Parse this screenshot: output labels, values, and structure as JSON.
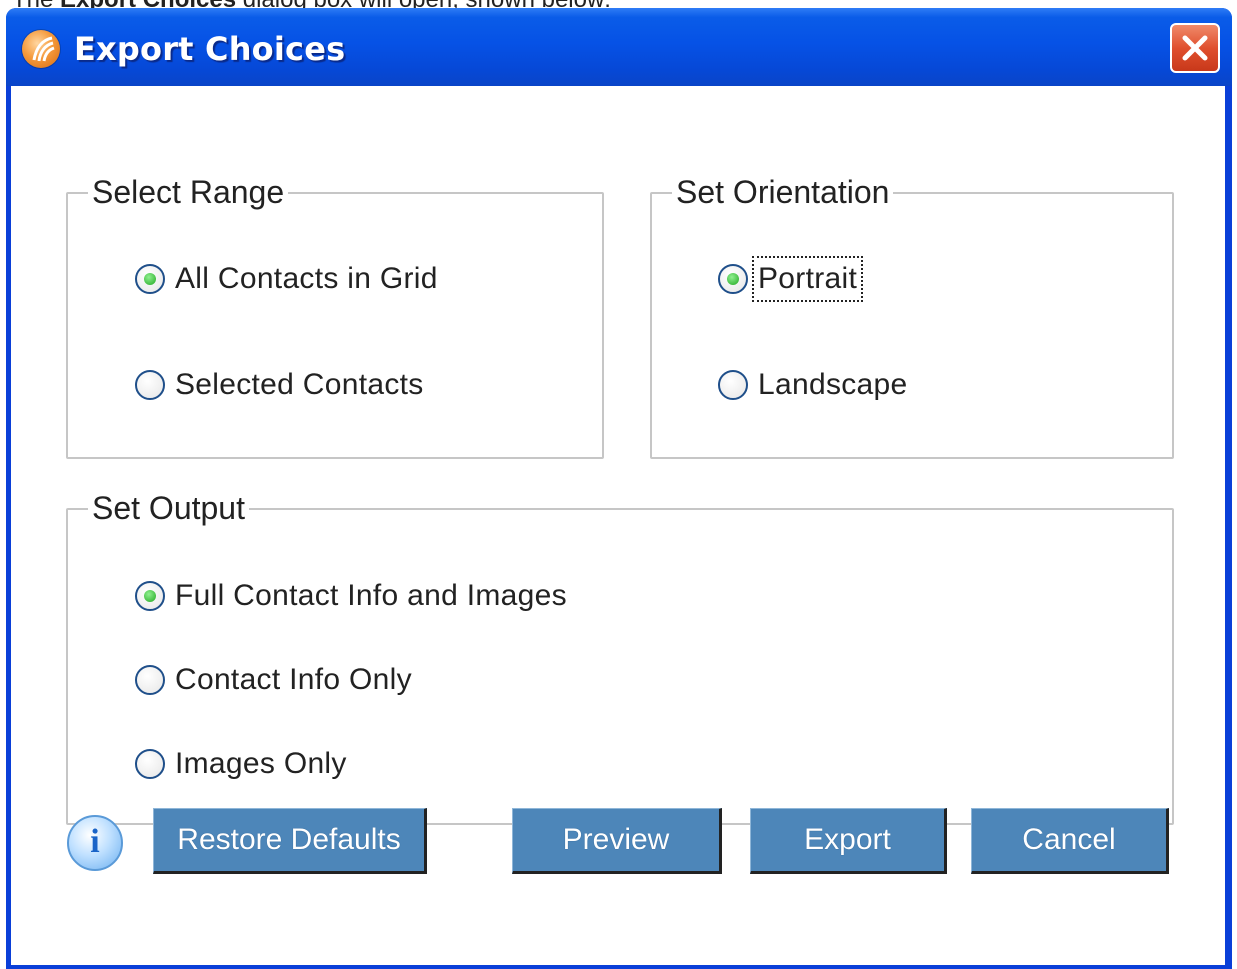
{
  "caption": {
    "prefix": "The ",
    "bold": "Export Choices",
    "suffix": " dialog box will open, shown below:"
  },
  "window": {
    "title": "Export Choices",
    "close_icon": "close-x-icon",
    "app_icon": "app-logo-icon"
  },
  "select_range": {
    "legend": "Select Range",
    "options": [
      {
        "label": "All Contacts in Grid",
        "checked": true
      },
      {
        "label": "Selected Contacts",
        "checked": false
      }
    ]
  },
  "set_orientation": {
    "legend": "Set Orientation",
    "options": [
      {
        "label": "Portrait",
        "checked": true
      },
      {
        "label": "Landscape",
        "checked": false
      }
    ]
  },
  "set_output": {
    "legend": "Set Output",
    "options": [
      {
        "label": "Full Contact Info and Images",
        "checked": true
      },
      {
        "label": "Contact Info Only",
        "checked": false
      },
      {
        "label": "Images Only",
        "checked": false
      }
    ]
  },
  "buttons": {
    "restore_defaults": "Restore Defaults",
    "preview": "Preview",
    "export": "Export",
    "cancel": "Cancel"
  },
  "info_icon": {
    "glyph": "i",
    "icon": "info-icon"
  },
  "colors": {
    "titlebar": "#0652e6",
    "button": "#4d86b9",
    "radio_dot": "#22a822",
    "close": "#e0502e"
  }
}
